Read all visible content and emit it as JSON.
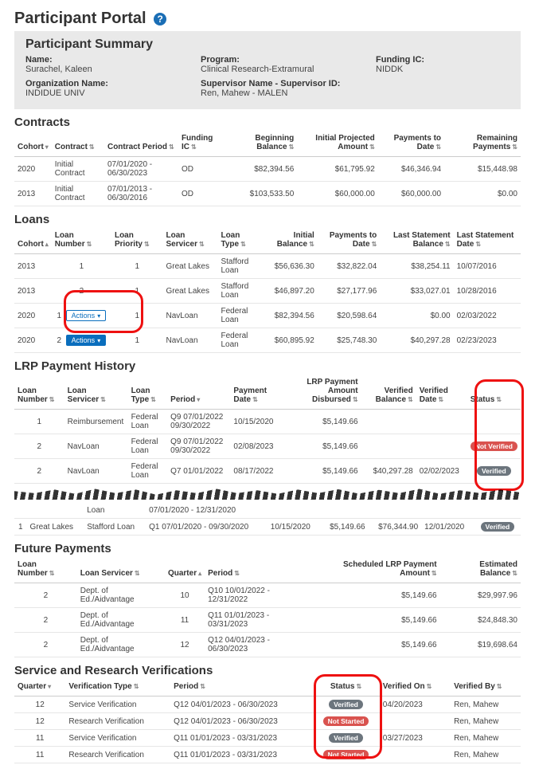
{
  "page": {
    "title": "Participant Portal"
  },
  "summary": {
    "title": "Participant Summary",
    "name_lbl": "Name:",
    "name_val": "Surachel,  Kaleen",
    "program_lbl": "Program:",
    "program_val": "Clinical Research-Extramural",
    "funding_lbl": "Funding IC:",
    "funding_val": "NIDDK",
    "org_lbl": "Organization Name:",
    "org_val": "INDIDUE UNIV",
    "sup_lbl": "Supervisor Name - Supervisor ID:",
    "sup_val": "Ren, Mahew  - MALEN"
  },
  "contracts": {
    "title": "Contracts",
    "headers": {
      "cohort": "Cohort",
      "contract": "Contract",
      "period": "Contract Period",
      "ic": "Funding IC",
      "begin": "Beginning Balance",
      "proj": "Initial Projected Amount",
      "paid": "Payments to Date",
      "remain": "Remaining Payments"
    },
    "rows": [
      {
        "cohort": "2020",
        "contract": "Initial Contract",
        "period": "07/01/2020 - 06/30/2023",
        "ic": "OD",
        "begin": "$82,394.56",
        "proj": "$61,795.92",
        "paid": "$46,346.94",
        "remain": "$15,448.98"
      },
      {
        "cohort": "2013",
        "contract": "Initial Contract",
        "period": "07/01/2013 - 06/30/2016",
        "ic": "OD",
        "begin": "$103,533.50",
        "proj": "$60,000.00",
        "paid": "$60,000.00",
        "remain": "$0.00"
      }
    ]
  },
  "loans": {
    "title": "Loans",
    "headers": {
      "cohort": "Cohort",
      "num": "Loan Number",
      "prio": "Loan Priority",
      "servicer": "Loan Servicer",
      "type": "Loan Type",
      "init": "Initial Balance",
      "paid": "Payments to Date",
      "lsb": "Last Statement Balance",
      "lsd": "Last Statement Date"
    },
    "actions_label": "Actions",
    "rows": [
      {
        "cohort": "2013",
        "num": "1",
        "prio": "1",
        "servicer": "Great Lakes",
        "type": "Stafford  Loan",
        "init": "$56,636.30",
        "paid": "$32,822.04",
        "lsb": "$38,254.11",
        "lsd": "10/07/2016"
      },
      {
        "cohort": "2013",
        "num": "2",
        "prio": "1",
        "servicer": "Great Lakes",
        "type": "Stafford  Loan",
        "init": "$46,897.20",
        "paid": "$27,177.96",
        "lsb": "$33,027.01",
        "lsd": "10/28/2016"
      },
      {
        "cohort": "2020",
        "num": "1",
        "prio": "1",
        "servicer": "NavLoan",
        "type": "Federal Loan",
        "init": "$82,394.56",
        "paid": "$20,598.64",
        "lsb": "$0.00",
        "lsd": "02/03/2022",
        "action": "outline"
      },
      {
        "cohort": "2020",
        "num": "2",
        "prio": "1",
        "servicer": "NavLoan",
        "type": "Federal Loan",
        "init": "$60,895.92",
        "paid": "$25,748.30",
        "lsb": "$40,297.28",
        "lsd": "02/23/2023",
        "action": "primary"
      }
    ]
  },
  "history": {
    "title": "LRP Payment History",
    "headers": {
      "num": "Loan Number",
      "servicer": "Loan Servicer",
      "type": "Loan Type",
      "period": "Period",
      "pdate": "Payment Date",
      "amt": "LRP Payment Amount Disbursed",
      "vbal": "Verified Balance",
      "vdate": "Verified Date",
      "status": "Status"
    },
    "rows_top": [
      {
        "num": "1",
        "servicer": "Reimbursement",
        "type": "Federal  Loan",
        "period": "Q9 07/01/2022  09/30/2022",
        "pdate": "10/15/2020",
        "amt": "$5,149.66",
        "vbal": "",
        "vdate": "",
        "status": ""
      },
      {
        "num": "2",
        "servicer": "NavLoan",
        "type": "Federal  Loan",
        "period": "Q9 07/01/2022  09/30/2022",
        "pdate": "02/08/2023",
        "amt": "$5,149.66",
        "vbal": "",
        "vdate": "",
        "status": "Not Verified"
      },
      {
        "num": "2",
        "servicer": "NavLoan",
        "type": "Federal  Loan",
        "period": "Q7 01/01/2022",
        "pdate": "08/17/2022",
        "amt": "$5,149.66",
        "vbal": "$40,297.28",
        "vdate": "02/02/2023",
        "status": "Verified"
      }
    ],
    "rows_bottom": [
      {
        "num": "",
        "servicer": "",
        "type": "Loan",
        "period": "07/01/2020 - 12/31/2020",
        "pdate": "",
        "amt": "",
        "vbal": "",
        "vdate": "",
        "status": ""
      },
      {
        "num": "1",
        "servicer": "Great Lakes",
        "type": "Stafford Loan",
        "period": "Q1 07/01/2020 - 09/30/2020",
        "pdate": "10/15/2020",
        "amt": "$5,149.66",
        "vbal": "$76,344.90",
        "vdate": "12/01/2020",
        "status": "Verified"
      }
    ]
  },
  "future": {
    "title": "Future Payments",
    "headers": {
      "num": "Loan Number",
      "servicer": "Loan Servicer",
      "quarter": "Quarter",
      "period": "Period",
      "sched": "Scheduled LRP Payment Amount",
      "est": "Estimated Balance"
    },
    "rows": [
      {
        "num": "2",
        "servicer": "Dept. of Ed./Aidvantage",
        "quarter": "10",
        "period": "Q10 10/01/2022 - 12/31/2022",
        "sched": "$5,149.66",
        "est": "$29,997.96"
      },
      {
        "num": "2",
        "servicer": "Dept. of Ed./Aidvantage",
        "quarter": "11",
        "period": "Q11 01/01/2023 - 03/31/2023",
        "sched": "$5,149.66",
        "est": "$24,848.30"
      },
      {
        "num": "2",
        "servicer": "Dept. of Ed./Aidvantage",
        "quarter": "12",
        "period": "Q12 04/01/2023 - 06/30/2023",
        "sched": "$5,149.66",
        "est": "$19,698.64"
      }
    ]
  },
  "verifications": {
    "title": "Service and Research Verifications",
    "headers": {
      "quarter": "Quarter",
      "type": "Verification Type",
      "period": "Period",
      "status": "Status",
      "on": "Verified On",
      "by": "Verified By"
    },
    "rows": [
      {
        "quarter": "12",
        "type": "Service Verification",
        "period": "Q12 04/01/2023 - 06/30/2023",
        "status": "Verified",
        "on": "04/20/2023",
        "by": "Ren, Mahew"
      },
      {
        "quarter": "12",
        "type": "Research Verification",
        "period": "Q12 04/01/2023 - 06/30/2023",
        "status": "Not Started",
        "on": "",
        "by": "Ren, Mahew"
      },
      {
        "quarter": "11",
        "type": "Service Verification",
        "period": "Q11 01/01/2023 - 03/31/2023",
        "status": "Verified",
        "on": "03/27/2023",
        "by": "Ren, Mahew"
      },
      {
        "quarter": "11",
        "type": "Research Verification",
        "period": "Q11 01/01/2023 - 03/31/2023",
        "status": "Not Started",
        "on": "",
        "by": "Ren, Mahew"
      }
    ]
  }
}
